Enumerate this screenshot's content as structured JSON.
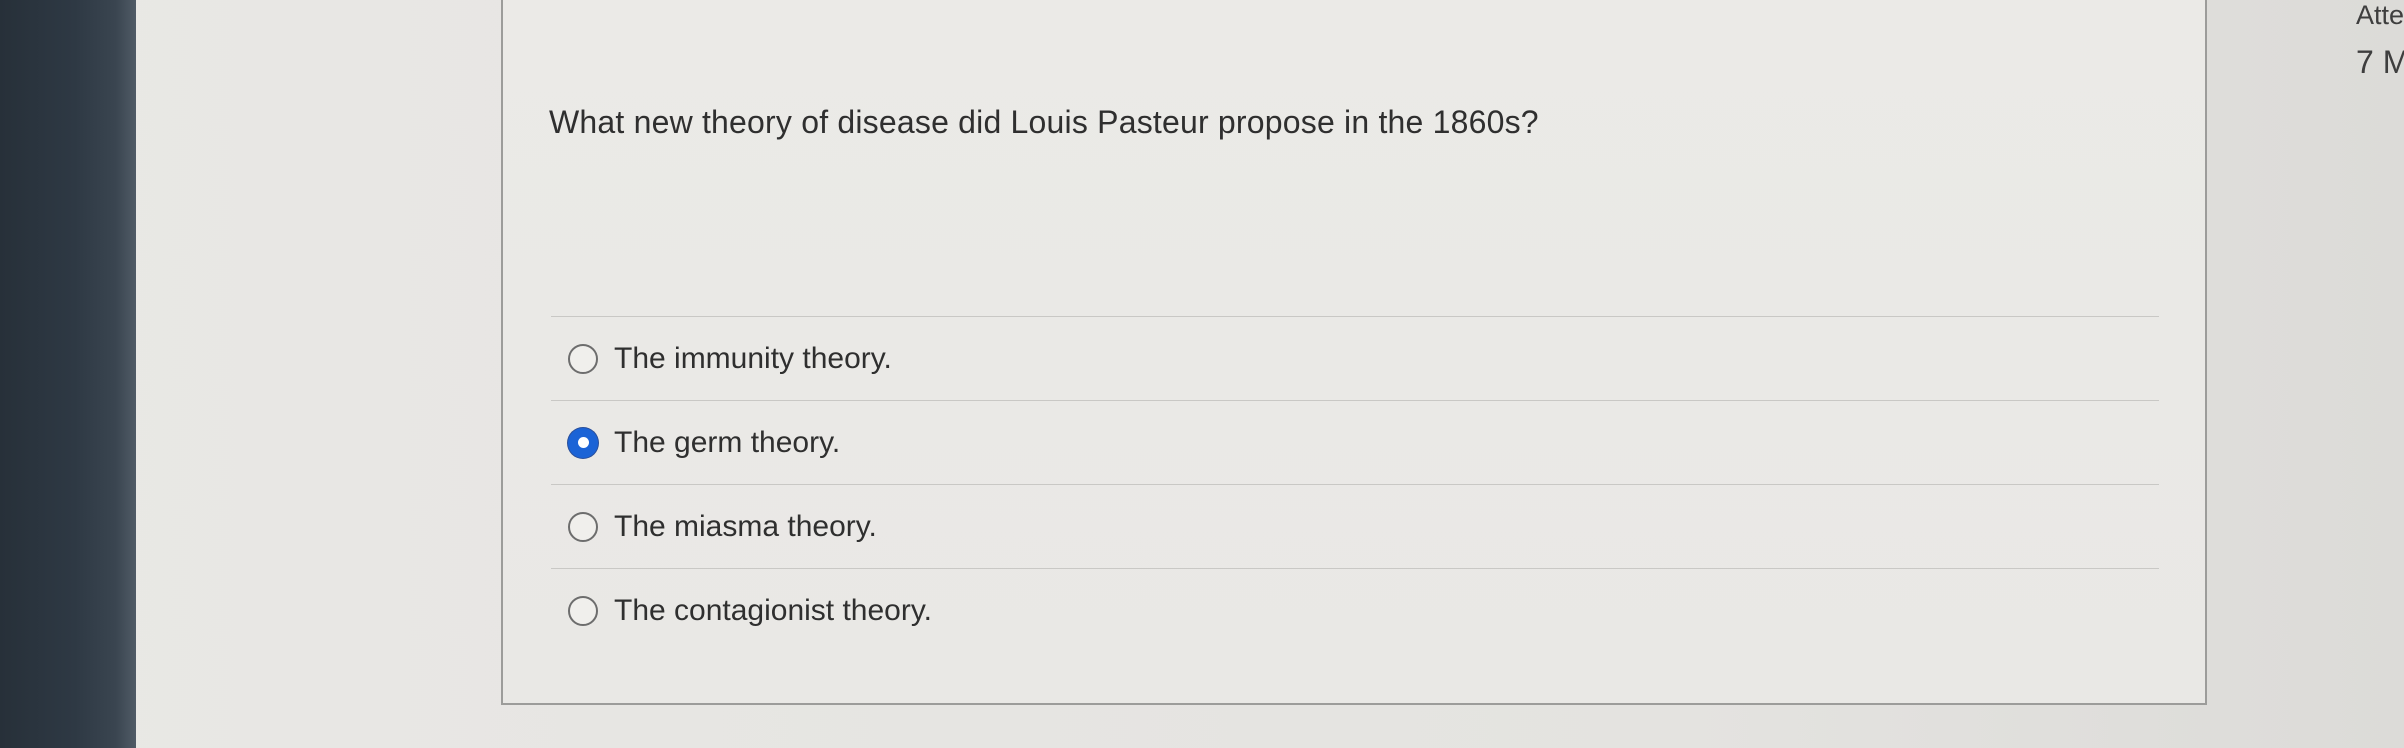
{
  "question": {
    "text": "What new theory of disease did Louis Pasteur propose in the 1860s?"
  },
  "options": [
    {
      "label": "The immunity theory.",
      "selected": false
    },
    {
      "label": "The germ theory.",
      "selected": true
    },
    {
      "label": "The miasma theory.",
      "selected": false
    },
    {
      "label": "The contagionist theory.",
      "selected": false
    }
  ],
  "side_panel": {
    "label": "Atte",
    "count": "7 M"
  },
  "colors": {
    "selected_radio": "#1b63d6",
    "left_bar": "#2e3944",
    "text": "#2f2f2f"
  }
}
